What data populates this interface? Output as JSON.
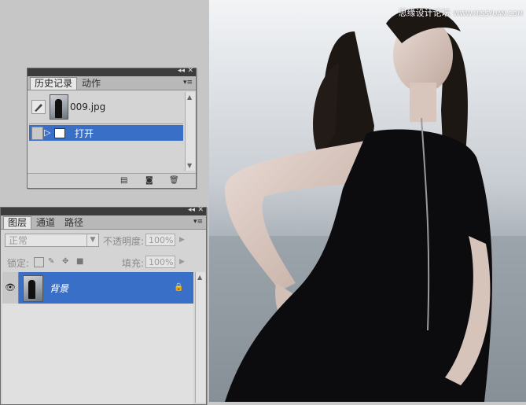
{
  "watermark": {
    "brand": "思缘设计论坛",
    "url": "WWW.MISSYUAN.COM"
  },
  "history_panel": {
    "tabs": [
      "历史记录",
      "动作"
    ],
    "snapshot_label": "009.jpg",
    "step_label": "打开"
  },
  "layers_panel": {
    "tabs": [
      "图层",
      "通道",
      "路径"
    ],
    "blend_mode": "正常",
    "opacity_label": "不透明度:",
    "opacity_value": "100%",
    "lock_label": "锁定:",
    "fill_label": "填充:",
    "fill_value": "100%",
    "layer_name": "背景"
  },
  "colors": {
    "selection": "#3a6fc7",
    "panel_bg": "#d4d4d4",
    "panel_titlebar": "#3c3c3c"
  }
}
